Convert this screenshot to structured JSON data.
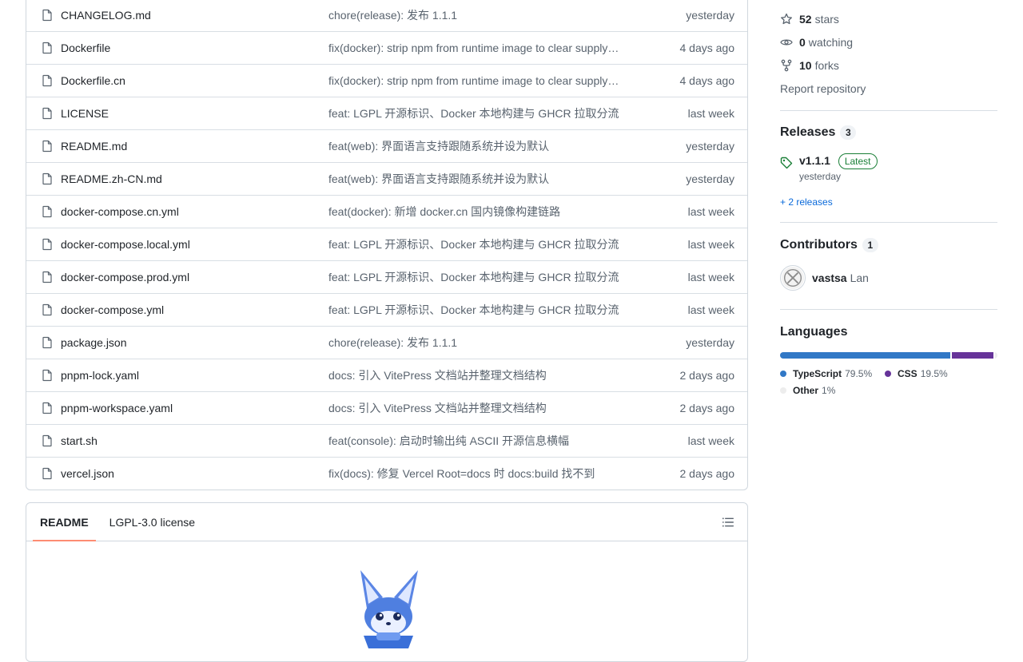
{
  "files": [
    {
      "name": "CHANGELOG.md",
      "message": "chore(release): 发布 1.1.1",
      "date": "yesterday"
    },
    {
      "name": "Dockerfile",
      "message": "fix(docker): strip npm from runtime image to clear supply-chain advisories",
      "date": "4 days ago"
    },
    {
      "name": "Dockerfile.cn",
      "message": "fix(docker): strip npm from runtime image to clear supply-chain advisories",
      "date": "4 days ago"
    },
    {
      "name": "LICENSE",
      "message": "feat: LGPL 开源标识、Docker 本地构建与 GHCR 拉取分流",
      "date": "last week"
    },
    {
      "name": "README.md",
      "message": "feat(web): 界面语言支持跟随系统并设为默认",
      "date": "yesterday"
    },
    {
      "name": "README.zh-CN.md",
      "message": "feat(web): 界面语言支持跟随系统并设为默认",
      "date": "yesterday"
    },
    {
      "name": "docker-compose.cn.yml",
      "message": "feat(docker): 新增 docker.cn 国内镜像构建链路",
      "date": "last week"
    },
    {
      "name": "docker-compose.local.yml",
      "message": "feat: LGPL 开源标识、Docker 本地构建与 GHCR 拉取分流",
      "date": "last week"
    },
    {
      "name": "docker-compose.prod.yml",
      "message": "feat: LGPL 开源标识、Docker 本地构建与 GHCR 拉取分流",
      "date": "last week"
    },
    {
      "name": "docker-compose.yml",
      "message": "feat: LGPL 开源标识、Docker 本地构建与 GHCR 拉取分流",
      "date": "last week"
    },
    {
      "name": "package.json",
      "message": "chore(release): 发布 1.1.1",
      "date": "yesterday"
    },
    {
      "name": "pnpm-lock.yaml",
      "message": "docs: 引入 VitePress 文档站并整理文档结构",
      "date": "2 days ago"
    },
    {
      "name": "pnpm-workspace.yaml",
      "message": "docs: 引入 VitePress 文档站并整理文档结构",
      "date": "2 days ago"
    },
    {
      "name": "start.sh",
      "message": "feat(console): 启动时输出纯 ASCII 开源信息横幅",
      "date": "last week"
    },
    {
      "name": "vercel.json",
      "message": "fix(docs): 修复 Vercel Root=docs 时 docs:build 找不到",
      "date": "2 days ago"
    }
  ],
  "readme": {
    "tabs": [
      "README",
      "LGPL-3.0 license"
    ],
    "active_tab": "README",
    "outline_icon": "list-unordered-icon",
    "mascot_icon": "fox-mascot-logo"
  },
  "sidebar": {
    "stars": {
      "count": "52",
      "label": "stars",
      "icon": "star-icon"
    },
    "watching": {
      "count": "0",
      "label": "watching",
      "icon": "eye-icon"
    },
    "forks": {
      "count": "10",
      "label": "forks",
      "icon": "repo-forked-icon"
    },
    "report_label": "Report repository",
    "releases": {
      "title": "Releases",
      "count": "3",
      "latest_name": "v1.1.1",
      "latest_badge": "Latest",
      "latest_date": "yesterday",
      "more_label": "+ 2 releases",
      "icon": "tag-icon"
    },
    "contributors": {
      "title": "Contributors",
      "count": "1",
      "login": "vastsa",
      "name": "Lan"
    },
    "languages": {
      "title": "Languages",
      "items": [
        {
          "name": "TypeScript",
          "percent": "79.5%",
          "value": 79.5,
          "color": "#3178c6"
        },
        {
          "name": "CSS",
          "percent": "19.5%",
          "value": 19.5,
          "color": "#663399"
        },
        {
          "name": "Other",
          "percent": "1%",
          "value": 1,
          "color": "#ededed"
        }
      ]
    }
  }
}
